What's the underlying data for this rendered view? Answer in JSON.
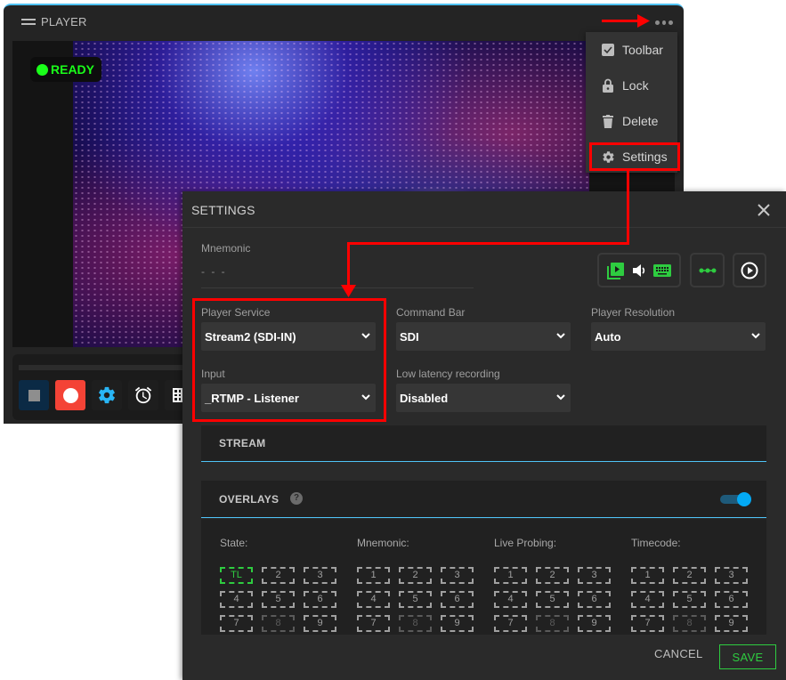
{
  "player": {
    "title": "PLAYER",
    "status": "READY",
    "status_color": "#1aff1a",
    "toolbar_icons": [
      "stop-icon",
      "record-icon",
      "gear-icon",
      "alarm-clock-icon",
      "grid-icon"
    ]
  },
  "context_menu": {
    "items": [
      {
        "label": "Toolbar",
        "icon": "checkbox-checked-icon"
      },
      {
        "label": "Lock",
        "icon": "lock-icon"
      },
      {
        "label": "Delete",
        "icon": "trash-icon"
      },
      {
        "label": "Settings",
        "icon": "gear-icon"
      }
    ]
  },
  "settings": {
    "title": "SETTINGS",
    "mnemonic": {
      "label": "Mnemonic",
      "value": "- - -"
    },
    "player_service": {
      "label": "Player Service",
      "value": "Stream2 (SDI-IN)"
    },
    "command_bar": {
      "label": "Command Bar",
      "value": "SDI"
    },
    "player_resolution": {
      "label": "Player Resolution",
      "value": "Auto"
    },
    "input": {
      "label": "Input",
      "value": "_RTMP - Listener"
    },
    "low_latency": {
      "label": "Low latency recording",
      "value": "Disabled"
    },
    "sections": {
      "stream": "STREAM",
      "overlays": "OVERLAYS",
      "overlays_help": "?",
      "overlays_enabled": true
    },
    "overlay_columns": [
      {
        "title": "State:",
        "cells": [
          "TL",
          "2",
          "3",
          "4",
          "5",
          "6",
          "7",
          "8",
          "9"
        ],
        "active": 0
      },
      {
        "title": "Mnemonic:",
        "cells": [
          "1",
          "2",
          "3",
          "4",
          "5",
          "6",
          "7",
          "8",
          "9"
        ],
        "active": -1
      },
      {
        "title": "Live Probing:",
        "cells": [
          "1",
          "2",
          "3",
          "4",
          "5",
          "6",
          "7",
          "8",
          "9"
        ],
        "active": -1
      },
      {
        "title": "Timecode:",
        "cells": [
          "1",
          "2",
          "3",
          "4",
          "5",
          "6",
          "7",
          "8",
          "9"
        ],
        "active": -1
      }
    ],
    "disabled_cell": "8",
    "cancel_label": "CANCEL",
    "save_label": "SAVE"
  },
  "colors": {
    "accent": "#4fc3f7",
    "save_green": "#2ecc40",
    "record_red": "#f44336",
    "annotation_red": "#ff0000"
  }
}
